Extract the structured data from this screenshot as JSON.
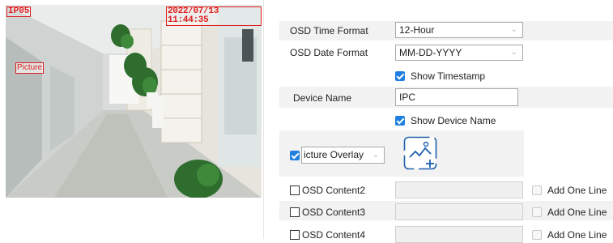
{
  "preview": {
    "osd_name": "IP05",
    "osd_time": "2022/07/13 11:44:35",
    "picture_overlay_label": "Picture"
  },
  "form": {
    "time_format": {
      "label": "OSD Time Format",
      "value": "12-Hour"
    },
    "date_format": {
      "label": "OSD Date Format",
      "value": "MM-DD-YYYY"
    },
    "show_timestamp": {
      "label": "Show Timestamp",
      "checked": true
    },
    "device_name": {
      "label": "Device Name",
      "value": "IPC"
    },
    "show_device_name": {
      "label": "Show Device Name",
      "checked": true
    },
    "picture_overlay": {
      "checked": true,
      "value": "icture Overlay"
    },
    "osd_contents": [
      {
        "label": "OSD Content2",
        "value": "",
        "add_one_line": "Add One Line"
      },
      {
        "label": "OSD Content3",
        "value": "",
        "add_one_line": "Add One Line"
      },
      {
        "label": "OSD Content4",
        "value": "",
        "add_one_line": "Add One Line"
      }
    ]
  },
  "icons": {
    "chevron": "chevron-down-icon",
    "upload": "image-upload-icon"
  },
  "colors": {
    "accent": "#1e7fe0",
    "osd_red": "#e01d1d",
    "row_band": "#f2f2f2"
  }
}
